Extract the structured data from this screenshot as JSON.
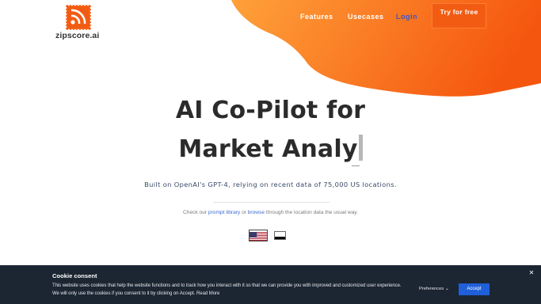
{
  "brand": {
    "name": "zipscore.ai",
    "logo_icon": "rss-stamp-icon",
    "accent_color": "#f25c12",
    "blob_color_light": "#ffa13a",
    "blob_color_dark": "#f5560f"
  },
  "nav": {
    "features": "Features",
    "usecases": "Usecases",
    "login": "Login",
    "cta": "Try for free"
  },
  "hero": {
    "title_line1": "AI Co-Pilot for",
    "title_line2": "Market Analy",
    "subtitle": "Built on OpenAI's GPT-4, relying on recent data of 75,000 US locations.",
    "hint_before": "Check our ",
    "hint_link1": "prompt library",
    "hint_mid": " or ",
    "hint_link2": "browse",
    "hint_after": " through the location data the usual way."
  },
  "languages": [
    {
      "icon": "us-flag-icon",
      "selected": true
    },
    {
      "icon": "germany-flag-icon",
      "selected": false
    }
  ],
  "cookie": {
    "title": "Cookie consent",
    "text": "This website uses cookies that help the website functions and to track how you interact with it so that we can provide you with improved and customized user experience. We will only use the cookies if you consent to it by clicking on Accept. Read More",
    "preferences": "Preferences",
    "accept": "Accept",
    "close_icon": "close-icon"
  }
}
